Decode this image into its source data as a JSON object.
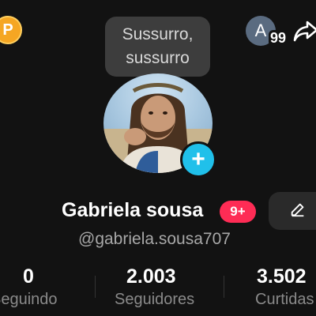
{
  "coin": {
    "label": "P"
  },
  "tooltip": {
    "line1": "Sussurro,",
    "line2": "sussurro"
  },
  "account": {
    "initial": "A",
    "count": "99"
  },
  "profile": {
    "name": "Gabriela sousa",
    "notification_badge": "9+",
    "username": "@gabriela.sousa707"
  },
  "stats": {
    "following": {
      "value": "0",
      "label": "Seguindo"
    },
    "followers": {
      "value": "2.003",
      "label": "Seguidores"
    },
    "likes": {
      "value": "3.502",
      "label": "Curtidas"
    }
  },
  "colors": {
    "background": "#121212",
    "add_button": "#20c0ea",
    "badge": "#fe2c55",
    "coin": "#f5a623"
  },
  "icons": [
    "coin-icon",
    "share-icon",
    "plus-icon",
    "pencil-icon"
  ]
}
